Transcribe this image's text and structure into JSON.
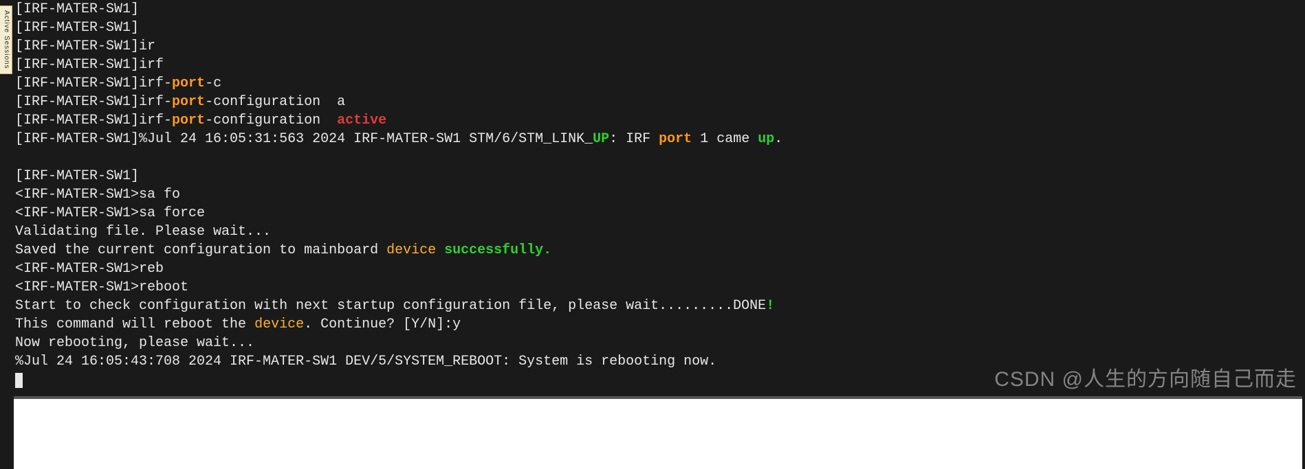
{
  "sidebar": {
    "label": "Active Sessions"
  },
  "prompt_bracket": "[IRF-MATER-SW1]",
  "prompt_angle": "<IRF-MATER-SW1>",
  "lines": {
    "l0": "[IRF-MATER-SW1]",
    "l1": "[IRF-MATER-SW1]",
    "l2_a": "[IRF-MATER-SW1]",
    "l2_b": "ir",
    "l3_a": "[IRF-MATER-SW1]",
    "l3_b": "irf",
    "l4_a": "[IRF-MATER-SW1]",
    "l4_b": "irf-",
    "l4_c": "port",
    "l4_d": "-c",
    "l5_a": "[IRF-MATER-SW1]",
    "l5_b": "irf-",
    "l5_c": "port",
    "l5_d": "-configuration  a",
    "l6_a": "[IRF-MATER-SW1]",
    "l6_b": "irf-",
    "l6_c": "port",
    "l6_d": "-configuration  ",
    "l6_e": "active",
    "l7_a": "[IRF-MATER-SW1]%Jul 24 16:05:31:563 2024 IRF-MATER-SW1 STM/6/STM_LINK_",
    "l7_b": "UP",
    "l7_c": ": IRF ",
    "l7_d": "port",
    "l7_e": " 1 came ",
    "l7_f": "up",
    "l7_g": ".",
    "l8": "",
    "l9": "[IRF-MATER-SW1]",
    "l10_a": "<IRF-MATER-SW1>",
    "l10_b": "sa fo",
    "l11_a": "<IRF-MATER-SW1>",
    "l11_b": "sa force",
    "l12": "Validating file. Please wait...",
    "l13_a": "Saved the current configuration to mainboard ",
    "l13_b": "device",
    "l13_c": " ",
    "l13_d": "successfully.",
    "l14_a": "<IRF-MATER-SW1>",
    "l14_b": "reb",
    "l15_a": "<IRF-MATER-SW1>",
    "l15_b": "reboot",
    "l16_a": "Start to check configuration with next startup configuration file, please wait.........DONE",
    "l16_b": "!",
    "l17_a": "This command will reboot the ",
    "l17_b": "device",
    "l17_c": ". Continue? [Y/N]:y",
    "l18": "Now rebooting, please wait...",
    "l19": "%Jul 24 16:05:43:708 2024 IRF-MATER-SW1 DEV/5/SYSTEM_REBOOT: System is rebooting now."
  },
  "watermark": "CSDN @人生的方向随自己而走"
}
